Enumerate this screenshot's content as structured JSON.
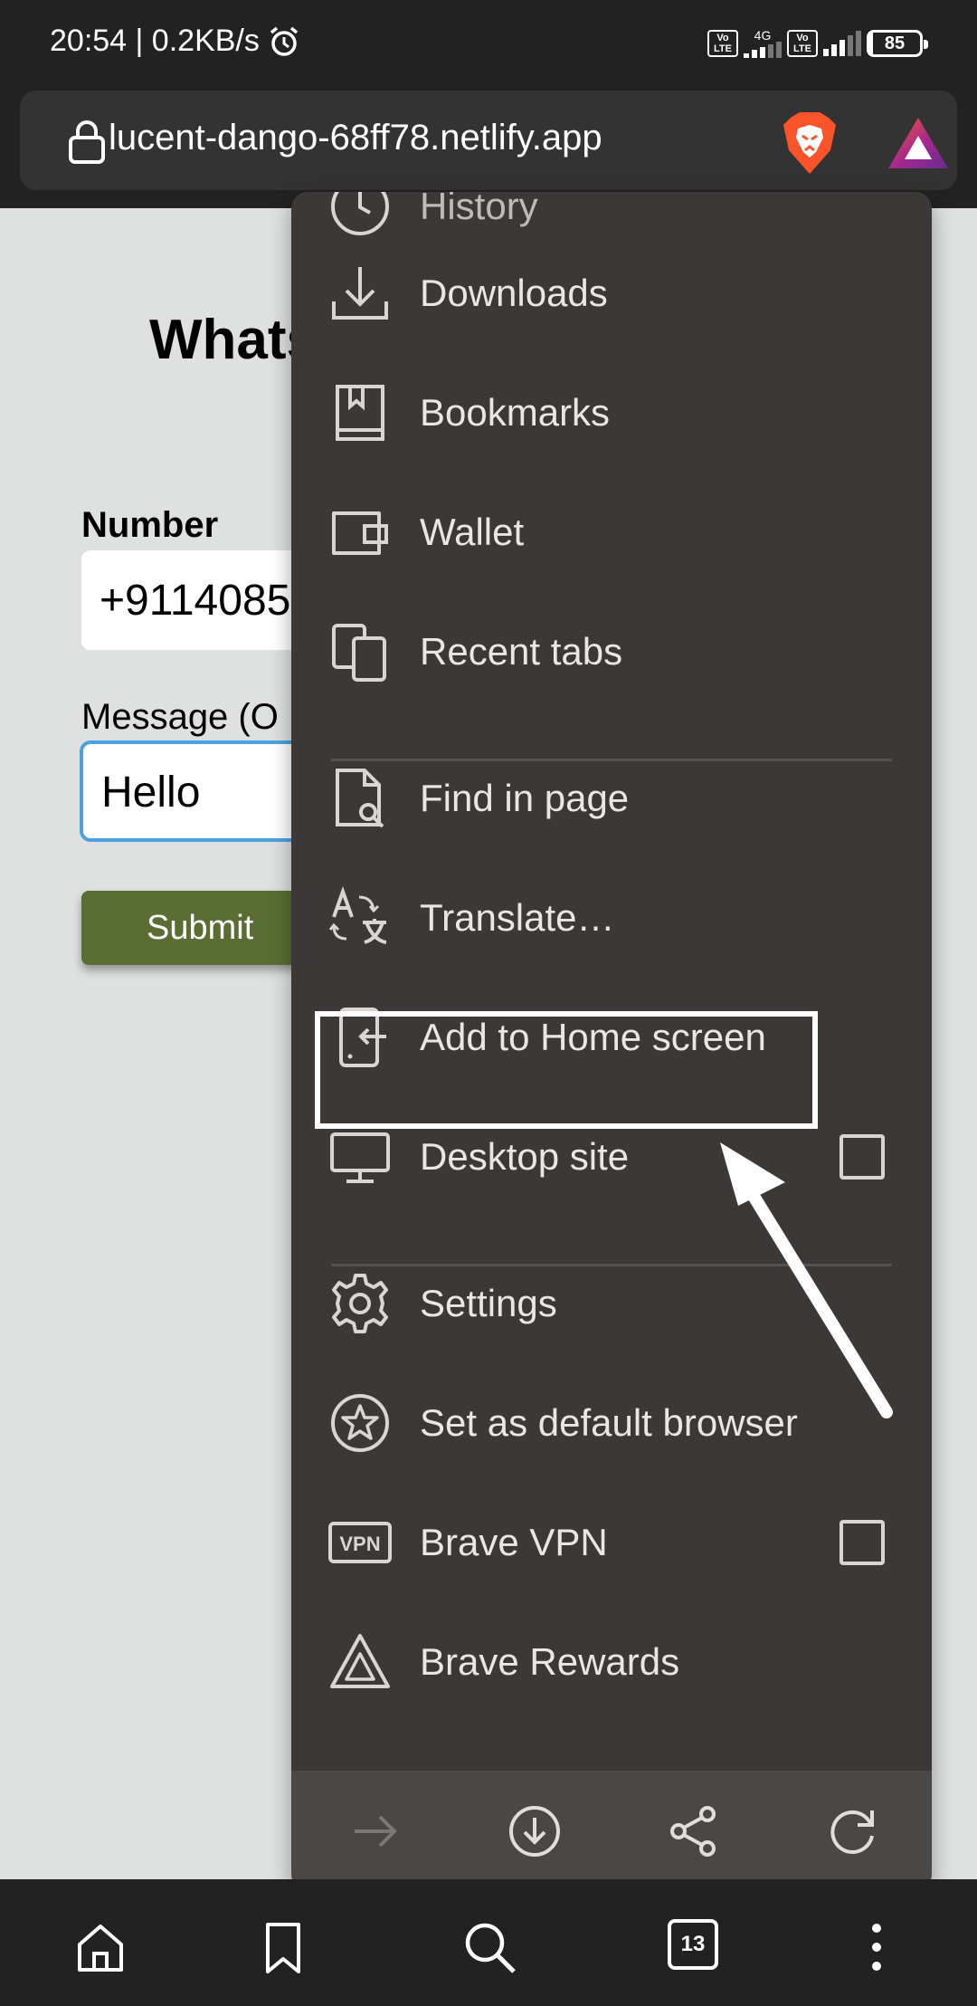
{
  "status_bar": {
    "time_speed": "20:54 | 0.2KB/s",
    "volte_1": "Vo LTE",
    "network_type": "4G",
    "volte_2": "Vo LTE",
    "battery": "85"
  },
  "toolbar": {
    "url": "lucent-dango-68ff78.netlify.app"
  },
  "page": {
    "title": "Whats",
    "number_label": "Number",
    "number_value": "+9114085",
    "message_label": "Message (O",
    "message_value": "Hello",
    "submit_label": "Submit"
  },
  "menu": {
    "items": [
      {
        "label": "History",
        "icon": "history-icon"
      },
      {
        "label": "Downloads",
        "icon": "download-icon"
      },
      {
        "label": "Bookmarks",
        "icon": "bookmarks-icon"
      },
      {
        "label": "Wallet",
        "icon": "wallet-icon"
      },
      {
        "label": "Recent tabs",
        "icon": "recent-tabs-icon"
      },
      {
        "label": "Find in page",
        "icon": "find-in-page-icon"
      },
      {
        "label": "Translate…",
        "icon": "translate-icon"
      },
      {
        "label": "Add to Home screen",
        "icon": "add-to-home-icon"
      },
      {
        "label": "Desktop site",
        "icon": "desktop-icon",
        "checked": false
      },
      {
        "label": "Settings",
        "icon": "gear-icon"
      },
      {
        "label": "Set as default browser",
        "icon": "star-circle-icon"
      },
      {
        "label": "Brave VPN",
        "icon": "vpn-icon",
        "checked": false
      },
      {
        "label": "Brave Rewards",
        "icon": "brave-rewards-icon"
      }
    ],
    "bottom_actions": [
      "forward-icon",
      "download-page-icon",
      "share-icon",
      "reload-icon"
    ]
  },
  "bottom_nav": {
    "tab_count": "13",
    "buttons": [
      "home-icon",
      "bookmark-icon",
      "search-icon",
      "tabs-icon",
      "more-icon"
    ]
  },
  "colors": {
    "menu_bg": "#3b3837",
    "bar_bg": "#222222",
    "submit_bg": "#5a6e33",
    "input_focus": "#4aa3df",
    "brave_orange": "#fb542b"
  }
}
